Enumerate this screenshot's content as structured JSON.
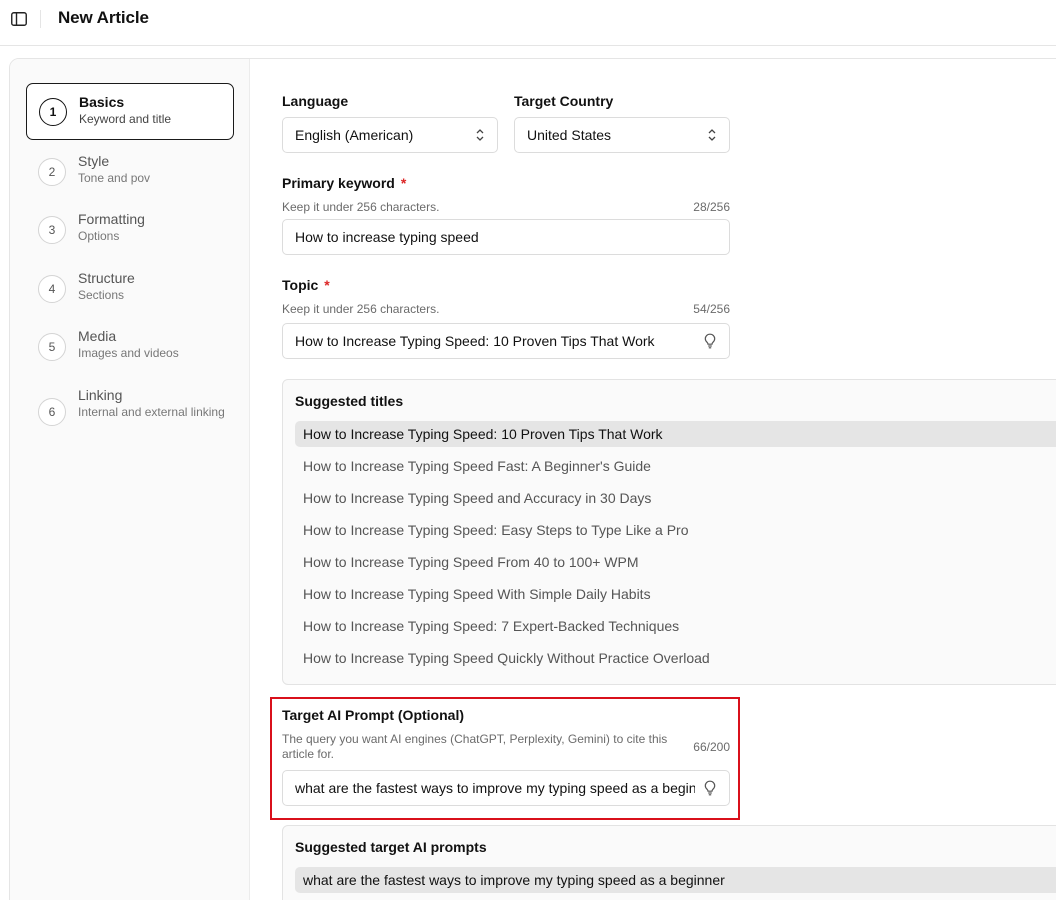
{
  "header": {
    "title": "New Article",
    "toggle_icon": "sidebar-toggle-icon"
  },
  "steps": [
    {
      "number": "1",
      "title": "Basics",
      "subtitle": "Keyword and title",
      "active": true
    },
    {
      "number": "2",
      "title": "Style",
      "subtitle": "Tone and pov",
      "active": false
    },
    {
      "number": "3",
      "title": "Formatting",
      "subtitle": "Options",
      "active": false
    },
    {
      "number": "4",
      "title": "Structure",
      "subtitle": "Sections",
      "active": false
    },
    {
      "number": "5",
      "title": "Media",
      "subtitle": "Images and videos",
      "active": false
    },
    {
      "number": "6",
      "title": "Linking",
      "subtitle": "Internal and external linking",
      "active": false
    }
  ],
  "language": {
    "label": "Language",
    "value": "English (American)"
  },
  "country": {
    "label": "Target Country",
    "value": "United States"
  },
  "primary_keyword": {
    "label": "Primary keyword",
    "required_mark": "*",
    "hint": "Keep it under 256 characters.",
    "counter": "28/256",
    "value": "How to increase typing speed"
  },
  "topic": {
    "label": "Topic",
    "required_mark": "*",
    "hint": "Keep it under 256 characters.",
    "counter": "54/256",
    "value": "How to Increase Typing Speed: 10 Proven Tips That Work"
  },
  "suggested_titles": {
    "heading": "Suggested titles",
    "items": [
      "How to Increase Typing Speed: 10 Proven Tips That Work",
      "How to Increase Typing Speed Fast: A Beginner's Guide",
      "How to Increase Typing Speed and Accuracy in 30 Days",
      "How to Increase Typing Speed: Easy Steps to Type Like a Pro",
      "How to Increase Typing Speed From 40 to 100+ WPM",
      "How to Increase Typing Speed With Simple Daily Habits",
      "How to Increase Typing Speed: 7 Expert-Backed Techniques",
      "How to Increase Typing Speed Quickly Without Practice Overload"
    ],
    "selected_index": 0
  },
  "target_ai_prompt": {
    "label": "Target AI Prompt (Optional)",
    "hint": "The query you want AI engines (ChatGPT, Perplexity, Gemini) to cite this article for.",
    "counter": "66/200",
    "value": "what are the fastest ways to improve my typing speed as a beginner"
  },
  "suggested_prompts": {
    "heading": "Suggested target AI prompts",
    "items": [
      "what are the fastest ways to improve my typing speed as a beginner"
    ]
  },
  "colors": {
    "accent": "#111111",
    "required": "#dc2626",
    "highlight": "#d9101b",
    "selected_bg": "#e5e5e5"
  }
}
